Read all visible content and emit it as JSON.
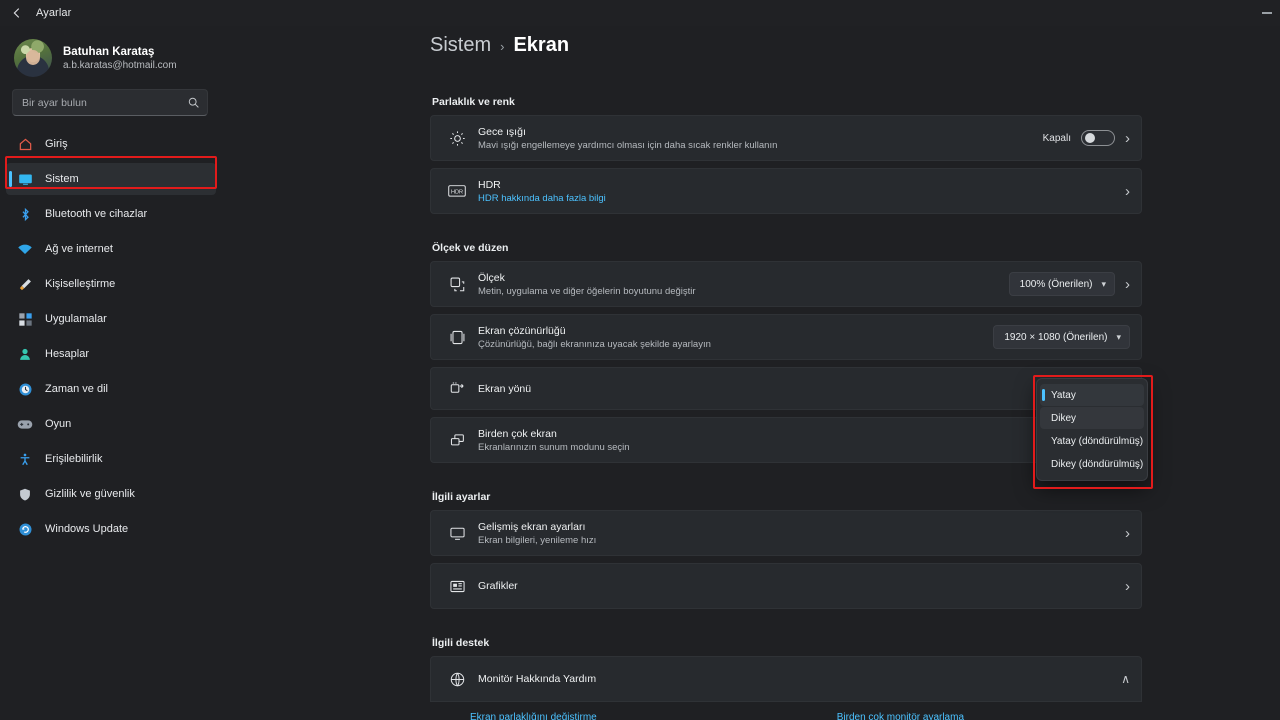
{
  "window": {
    "title": "Ayarlar",
    "back_icon": "back-arrow-icon",
    "minimize_label": "—"
  },
  "account": {
    "name": "Batuhan Karataş",
    "email": "a.b.karatas@hotmail.com"
  },
  "search": {
    "placeholder": "Bir ayar bulun",
    "value": "",
    "icon": "search-icon"
  },
  "sidebar": {
    "items": [
      {
        "label": "Giriş",
        "icon": "home-icon",
        "selected": false
      },
      {
        "label": "Sistem",
        "icon": "display-icon",
        "selected": true
      },
      {
        "label": "Bluetooth ve cihazlar",
        "icon": "bluetooth-icon",
        "selected": false
      },
      {
        "label": "Ağ ve internet",
        "icon": "wifi-icon",
        "selected": false
      },
      {
        "label": "Kişiselleştirme",
        "icon": "brush-icon",
        "selected": false
      },
      {
        "label": "Uygulamalar",
        "icon": "apps-icon",
        "selected": false
      },
      {
        "label": "Hesaplar",
        "icon": "person-icon",
        "selected": false
      },
      {
        "label": "Zaman ve dil",
        "icon": "clock-icon",
        "selected": false
      },
      {
        "label": "Oyun",
        "icon": "gamepad-icon",
        "selected": false
      },
      {
        "label": "Erişilebilirlik",
        "icon": "accessibility-icon",
        "selected": false
      },
      {
        "label": "Gizlilik ve güvenlik",
        "icon": "shield-icon",
        "selected": false
      },
      {
        "label": "Windows Update",
        "icon": "update-icon",
        "selected": false
      }
    ]
  },
  "breadcrumb": {
    "parent": "Sistem",
    "separator": "›",
    "current": "Ekran"
  },
  "sections": {
    "brightness": {
      "header": "Parlaklık ve renk",
      "night_light": {
        "title": "Gece ışığı",
        "subtitle": "Mavi ışığı engellemeye yardımcı olması için daha sıcak renkler kullanın",
        "state": "Kapalı",
        "toggle_on": false
      },
      "hdr": {
        "title": "HDR",
        "subtitle": "HDR hakkında daha fazla bilgi"
      }
    },
    "scale": {
      "header": "Ölçek ve düzen",
      "scale_item": {
        "title": "Ölçek",
        "subtitle": "Metin, uygulama ve diğer öğelerin boyutunu değiştir",
        "value": "100% (Önerilen)"
      },
      "resolution_item": {
        "title": "Ekran çözünürlüğü",
        "subtitle": "Çözünürlüğü, bağlı ekranınıza uyacak şekilde ayarlayın",
        "value": "1920 × 1080 (Önerilen)"
      },
      "orientation_item": {
        "title": "Ekran yönü"
      },
      "multi_display_item": {
        "title": "Birden çok ekran",
        "subtitle": "Ekranlarınızın sunum modunu seçin"
      }
    },
    "related_settings": {
      "header": "İlgili ayarlar",
      "advanced": {
        "title": "Gelişmiş ekran ayarları",
        "subtitle": "Ekran bilgileri, yenileme hızı"
      },
      "graphics": {
        "title": "Grafikler"
      }
    },
    "related_support": {
      "header": "İlgili destek",
      "monitor_help": {
        "title": "Monitör Hakkında Yardım",
        "expanded": true
      },
      "links": [
        "Ekran parlaklığını değiştirme",
        "Birden çok monitör ayarlama"
      ]
    }
  },
  "orientation_dropdown": {
    "open": true,
    "options": [
      {
        "label": "Yatay",
        "selected": true,
        "hover": false
      },
      {
        "label": "Dikey",
        "selected": false,
        "hover": true
      },
      {
        "label": "Yatay (döndürülmüş)",
        "selected": false,
        "hover": false
      },
      {
        "label": "Dikey (döndürülmüş)",
        "selected": false,
        "hover": false
      }
    ]
  },
  "colors": {
    "accent": "#4cc2ff",
    "annotation": "#e21b1b",
    "card_bg": "#272a2e",
    "page_bg": "#1f2023"
  }
}
